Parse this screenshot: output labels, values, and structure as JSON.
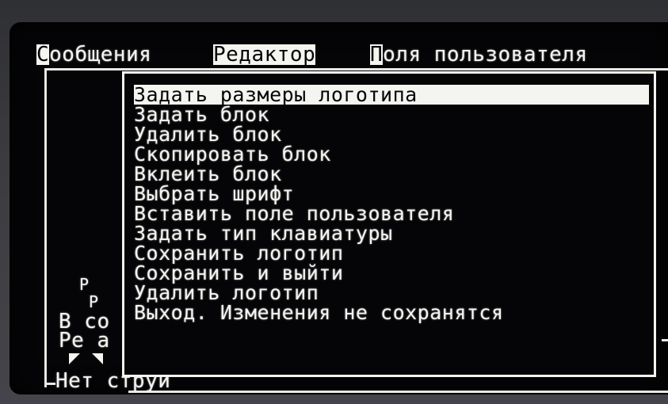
{
  "menubar": {
    "messages": {
      "cursor": "С",
      "rest": "ообщения"
    },
    "editor": "Редактор",
    "user_fields": {
      "cursor": "П",
      "rest": "оля пользователя"
    }
  },
  "editor_menu": {
    "items": [
      {
        "label": "Задать размеры логотипа"
      },
      {
        "label": "Задать блок"
      },
      {
        "label": "Удалить блок"
      },
      {
        "label": "Скопировать блок"
      },
      {
        "label": "Вклеить блок"
      },
      {
        "label": "Выбрать шрифт"
      },
      {
        "label": "Вставить поле пользователя"
      },
      {
        "label": "Задать тип клавиатуры"
      },
      {
        "label": "Сохранить логотип"
      },
      {
        "label": "Сохранить и выйти"
      },
      {
        "label": "Удалить логотип"
      },
      {
        "label": "Выход. Изменения не сохранятся"
      }
    ],
    "selected_index": 0
  },
  "background": {
    "fragment_1": "Р",
    "fragment_2": "Р",
    "line_1": "В со",
    "line_2": "Ре а",
    "status": "Нет струи"
  },
  "colors": {
    "screen_bg": "#050507",
    "text": "#f4f4f0",
    "bezel": "#3a3a3c"
  }
}
